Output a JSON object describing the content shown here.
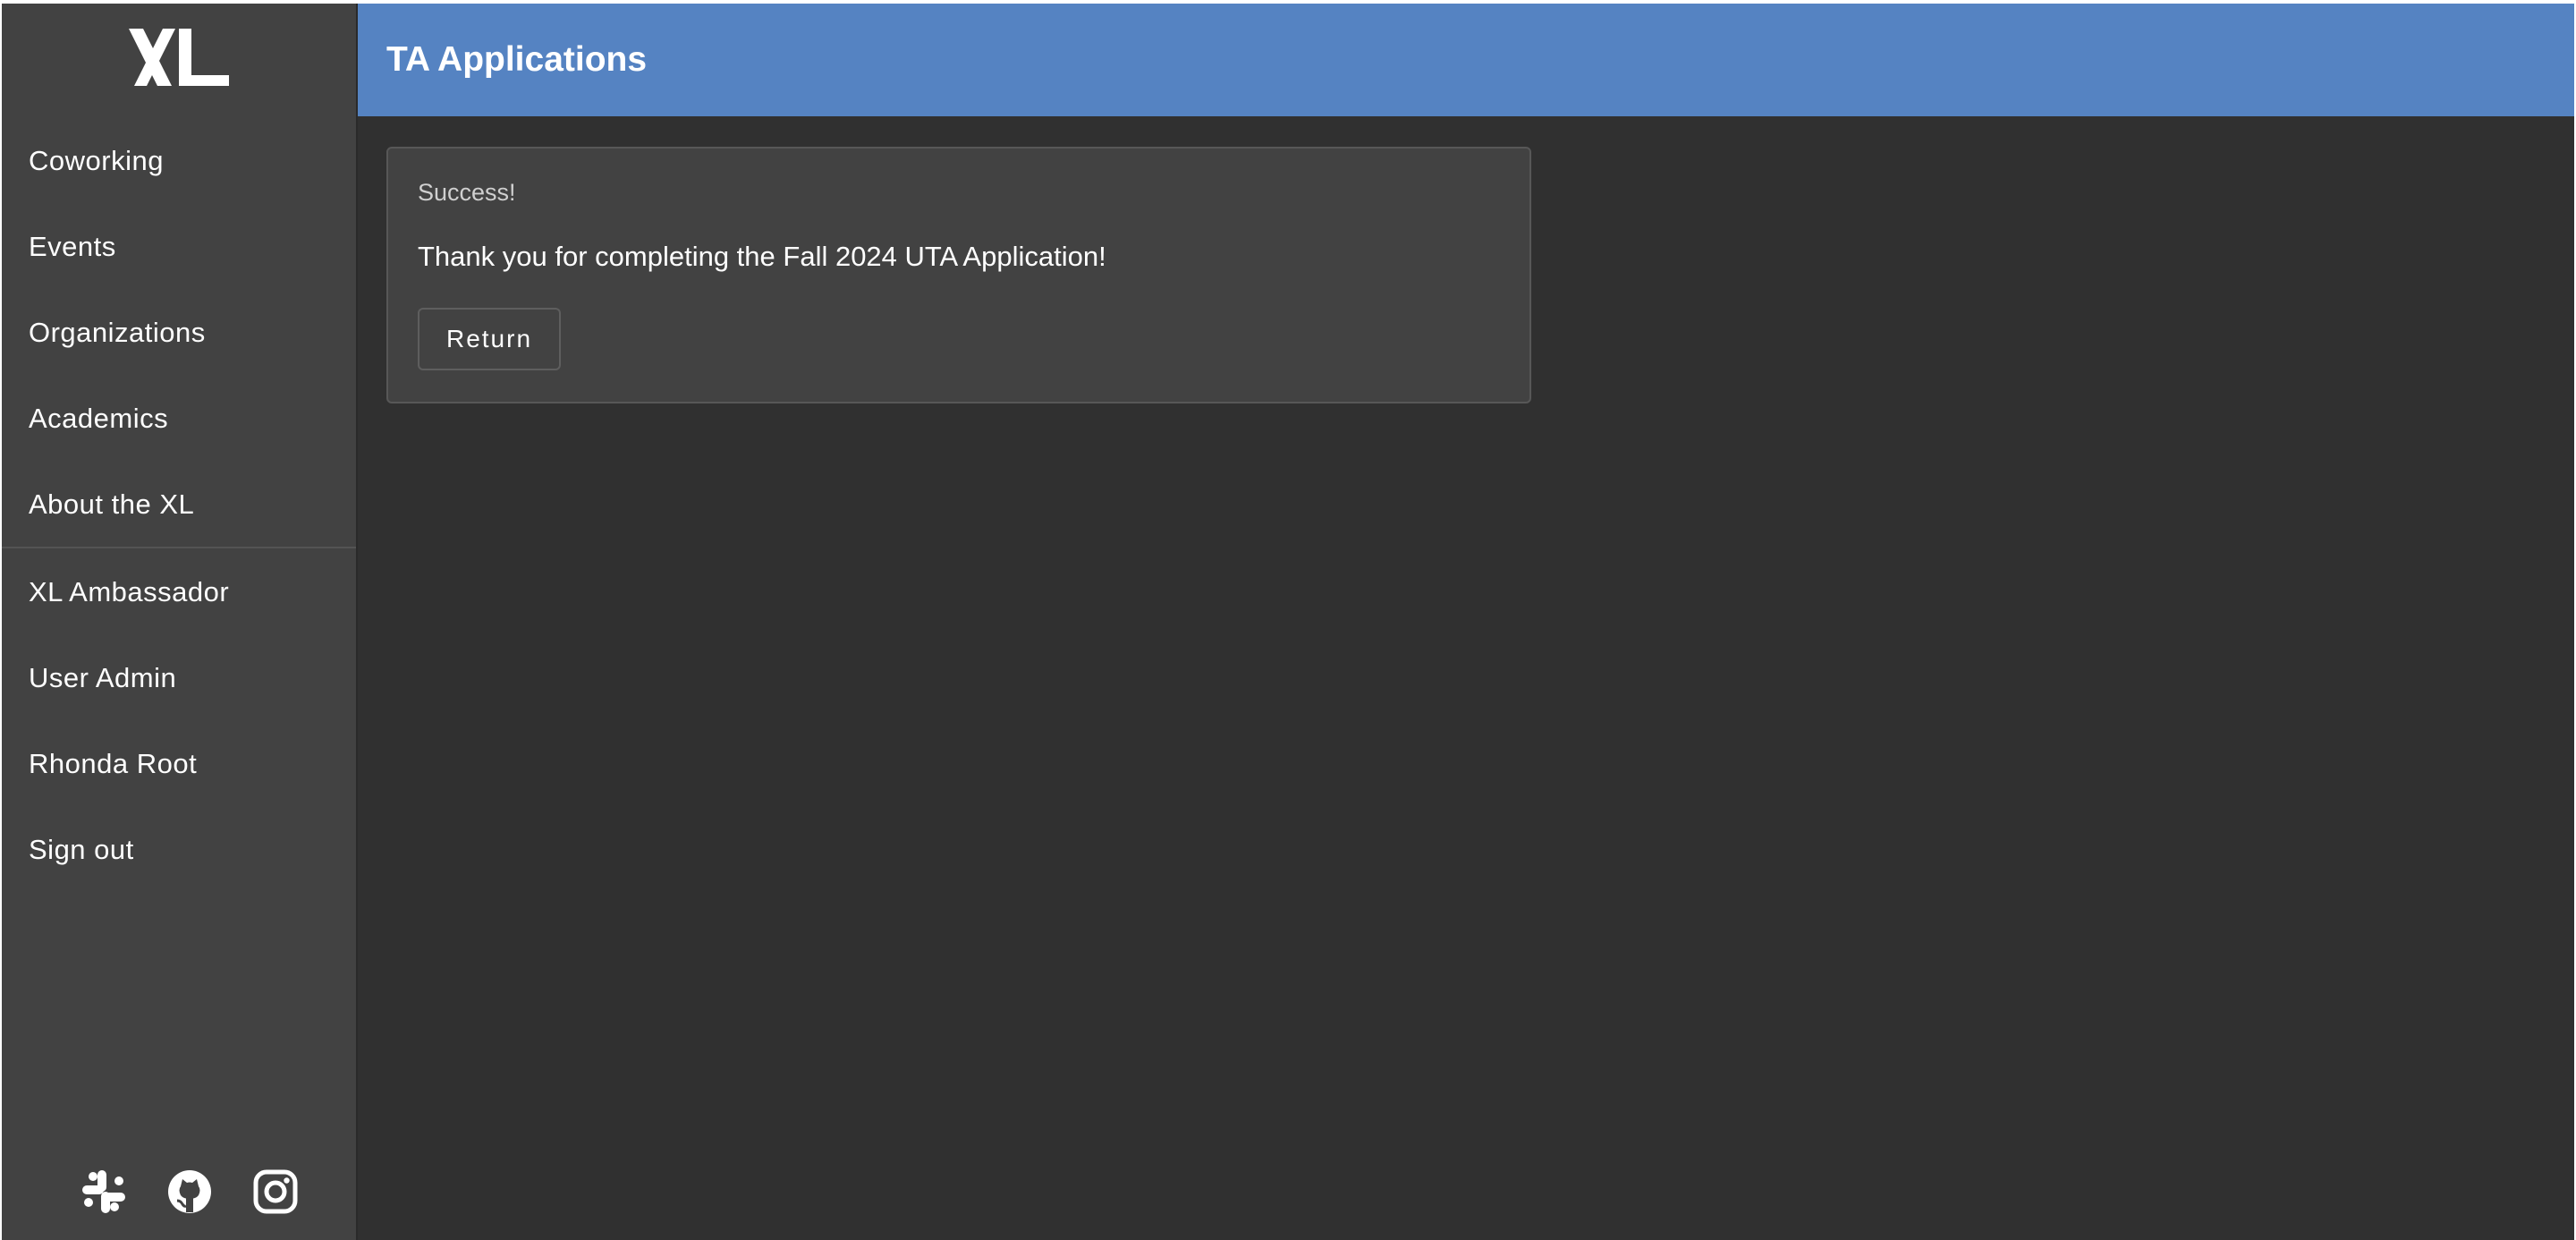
{
  "sidebar": {
    "logo_icon": "xl-logo",
    "items": [
      {
        "label": "Coworking"
      },
      {
        "label": "Events"
      },
      {
        "label": "Organizations"
      },
      {
        "label": "Academics"
      },
      {
        "label": "About the XL"
      },
      {
        "label": "XL Ambassador"
      },
      {
        "label": "User Admin"
      },
      {
        "label": "Rhonda Root"
      },
      {
        "label": "Sign out"
      }
    ],
    "social": [
      {
        "icon": "slack-icon"
      },
      {
        "icon": "github-icon"
      },
      {
        "icon": "instagram-icon"
      }
    ]
  },
  "header": {
    "title": "TA Applications"
  },
  "card": {
    "subtitle": "Success!",
    "message": "Thank you for completing the Fall 2024 UTA Application!",
    "return_label": "Return"
  },
  "colors": {
    "header_accent": "#5583c2",
    "sidebar_bg": "#424242",
    "content_bg": "#303030",
    "card_bg": "#424242"
  }
}
